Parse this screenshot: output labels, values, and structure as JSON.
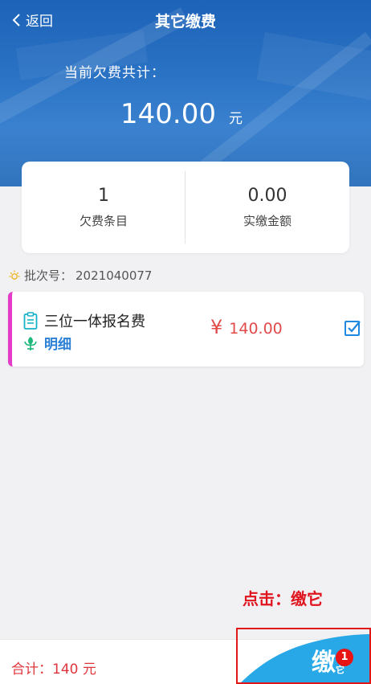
{
  "header": {
    "back_label": "返回",
    "title": "其它缴费",
    "total_label": "当前欠费共计：",
    "total_amount": "140.00",
    "total_unit": "元"
  },
  "stats": [
    {
      "value": "1",
      "label": "欠费条目"
    },
    {
      "value": "0.00",
      "label": "实缴金额"
    }
  ],
  "batch": {
    "label": "批次号：",
    "number": "2021040077"
  },
  "fee_items": [
    {
      "name": "三位一体报名费",
      "detail_label": "明细",
      "currency": "¥",
      "amount": "140.00",
      "checked": true
    }
  ],
  "annotation": "点击：缴它",
  "footer": {
    "sum_label": "合计：140 元",
    "pay_glyph": "缴",
    "pay_glyph_small": "它",
    "badge_count": "1"
  },
  "colors": {
    "header_blue": "#2a72c4",
    "accent_red": "#e24a4a",
    "link_blue": "#2a7fd6",
    "card_stripe": "#e53cc8",
    "pay_button": "#29a8e8"
  },
  "icons": {
    "back": "chevron-left-icon",
    "batch": "sun-icon",
    "fee": "clipboard-icon",
    "detail": "leaf-icon",
    "checkbox": "checkbox-checked-icon"
  }
}
